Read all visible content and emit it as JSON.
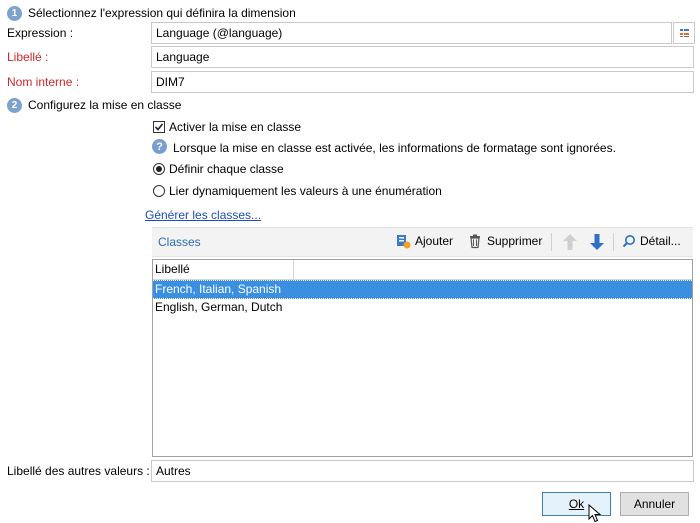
{
  "step1": {
    "number": "1",
    "title": "Sélectionnez l'expression qui définira la dimension"
  },
  "form": {
    "expression_label": "Expression :",
    "expression_value": "Language (@language)",
    "libelle_label": "Libellé :",
    "libelle_value": "Language",
    "nom_interne_label": "Nom interne :",
    "nom_interne_value": "DIM7"
  },
  "step2": {
    "number": "2",
    "title": "Configurez la mise en classe"
  },
  "options": {
    "activer_label": "Activer la mise en classe",
    "activer_checked": true,
    "info_text": "Lorsque la mise en classe est activée, les informations de formatage sont ignorées.",
    "definir_label": "Définir chaque classe",
    "lier_label": "Lier dynamiquement les valeurs à une énumération",
    "selected_radio": "definir"
  },
  "generate_link": "Générer les classes...",
  "toolbar": {
    "title": "Classes",
    "add_label": "Ajouter",
    "delete_label": "Supprimer",
    "detail_label": "Détail..."
  },
  "grid": {
    "column_header": "Libellé",
    "rows": [
      "French, Italian, Spanish",
      "English, German, Dutch"
    ],
    "selected_index": 0
  },
  "other_values": {
    "label": "Libellé des autres valeurs :",
    "value": "Autres"
  },
  "buttons": {
    "ok_label": "Ok",
    "cancel_label": "Annuler"
  },
  "colors": {
    "accent": "#3a8fe0",
    "error_label": "#d2262c",
    "link": "#1a4fbf"
  }
}
